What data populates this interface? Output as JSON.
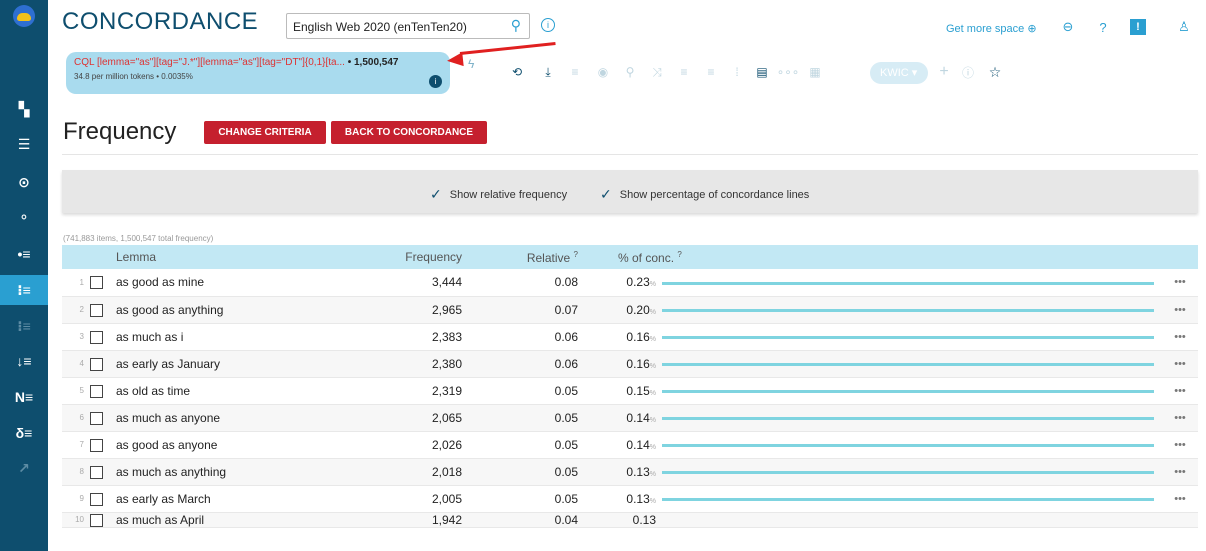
{
  "app": {
    "title": "CONCORDANCE",
    "corpus": "English Web 2020 (enTenTen20)",
    "get_more_space": "Get more space"
  },
  "query": {
    "cql": "CQL [lemma=\"as\"][tag=\"J.*\"][lemma=\"as\"][tag=\"DT\"]{0,1}[ta...",
    "hits": "• 1,500,547",
    "meta": "34.8 per million tokens • 0.0035%"
  },
  "toolbar": {
    "view_mode": "KWIC"
  },
  "page": {
    "title": "Frequency",
    "change_criteria": "CHANGE CRITERIA",
    "back_to_concordance": "BACK TO CONCORDANCE"
  },
  "options": {
    "show_relative": "Show relative frequency",
    "show_percentage": "Show percentage of concordance lines"
  },
  "summary": "(741,883 items, 1,500,547 total frequency)",
  "table": {
    "headers": {
      "lemma": "Lemma",
      "frequency": "Frequency",
      "relative": "Relative",
      "relative_sup": "?",
      "pct": "% of conc.",
      "pct_sup": "?"
    },
    "rows": [
      {
        "n": "1",
        "lemma": "as good as mine",
        "freq": "3,444",
        "rel": "0.08",
        "pct": "0.23",
        "pct_unit": "%",
        "share": 0.23
      },
      {
        "n": "2",
        "lemma": "as good as anything",
        "freq": "2,965",
        "rel": "0.07",
        "pct": "0.20",
        "pct_unit": "%",
        "share": 0.2
      },
      {
        "n": "3",
        "lemma": "as much as i",
        "freq": "2,383",
        "rel": "0.06",
        "pct": "0.16",
        "pct_unit": "%",
        "share": 0.16
      },
      {
        "n": "4",
        "lemma": "as early as January",
        "freq": "2,380",
        "rel": "0.06",
        "pct": "0.16",
        "pct_unit": "%",
        "share": 0.16
      },
      {
        "n": "5",
        "lemma": "as old as time",
        "freq": "2,319",
        "rel": "0.05",
        "pct": "0.15",
        "pct_unit": "%",
        "share": 0.15
      },
      {
        "n": "6",
        "lemma": "as much as anyone",
        "freq": "2,065",
        "rel": "0.05",
        "pct": "0.14",
        "pct_unit": "%",
        "share": 0.14
      },
      {
        "n": "7",
        "lemma": "as good as anyone",
        "freq": "2,026",
        "rel": "0.05",
        "pct": "0.14",
        "pct_unit": "%",
        "share": 0.14
      },
      {
        "n": "8",
        "lemma": "as much as anything",
        "freq": "2,018",
        "rel": "0.05",
        "pct": "0.13",
        "pct_unit": "%",
        "share": 0.13
      },
      {
        "n": "9",
        "lemma": "as early as March",
        "freq": "2,005",
        "rel": "0.05",
        "pct": "0.13",
        "pct_unit": "%",
        "share": 0.13
      }
    ],
    "cut_row": {
      "n": "10",
      "lemma": "as much as April",
      "freq": "1,942",
      "rel": "0.04",
      "pct": "0.13"
    }
  },
  "colors": {
    "sidebar": "#0e4e6e",
    "accent": "#2a9fd1",
    "danger_button": "#c5202e",
    "table_header": "#c2e8f4",
    "bar": "#7fd4e0",
    "annotation_arrow": "#e02020"
  }
}
